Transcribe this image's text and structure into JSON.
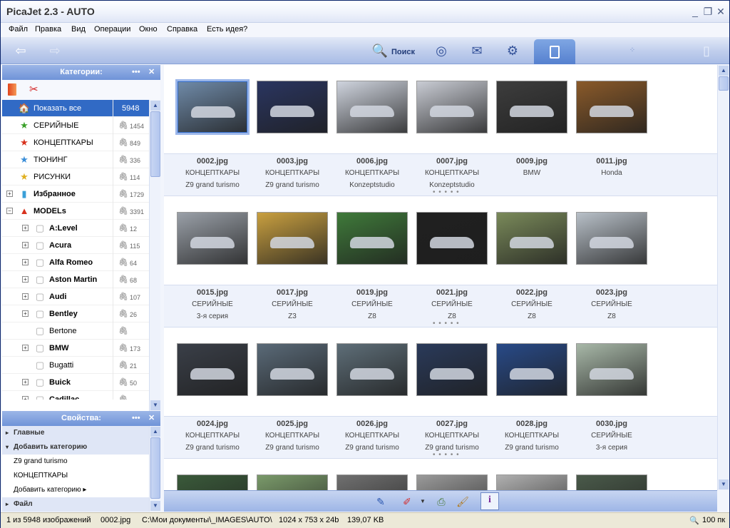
{
  "window": {
    "title": "PicaJet 2.3 - AUTO",
    "minimize": "_",
    "restore": "❐",
    "close": "✕"
  },
  "menu": [
    "Файл",
    "Правка",
    "Вид",
    "Операции",
    "Окно",
    "Справка",
    "Есть идея?"
  ],
  "toolbar": {
    "search_label": "Поиск",
    "back_icon": "back-arrow",
    "forward_icon": "forward-arrow"
  },
  "categories_panel": {
    "title": "Категории:",
    "dots": "•••",
    "close": "✕"
  },
  "categories": [
    {
      "label": "Показать все",
      "count": "5948",
      "icon": "home",
      "bold": false,
      "selected": true
    },
    {
      "label": "СЕРИЙНЫЕ",
      "count": "1454",
      "icon": "star-green"
    },
    {
      "label": "КОНЦЕПТКАРЫ",
      "count": "849",
      "icon": "star-red"
    },
    {
      "label": "ТЮНИНГ",
      "count": "336",
      "icon": "star-blue"
    },
    {
      "label": "РИСУНКИ",
      "count": "114",
      "icon": "star-yellow"
    },
    {
      "label": "Избранное",
      "count": "1729",
      "icon": "cylinder",
      "bold": true,
      "expand": "+"
    },
    {
      "label": "MODELs",
      "count": "3391",
      "icon": "cone",
      "bold": true,
      "expand": "−"
    },
    {
      "label": "A:Level",
      "count": "12",
      "bold": true,
      "expand": "+",
      "indent": true
    },
    {
      "label": "Acura",
      "count": "115",
      "bold": true,
      "expand": "+",
      "indent": true
    },
    {
      "label": "Alfa Romeo",
      "count": "64",
      "bold": true,
      "expand": "+",
      "indent": true
    },
    {
      "label": "Aston Martin",
      "count": "68",
      "bold": true,
      "expand": "+",
      "indent": true
    },
    {
      "label": "Audi",
      "count": "107",
      "bold": true,
      "expand": "+",
      "indent": true
    },
    {
      "label": "Bentley",
      "count": "26",
      "bold": true,
      "expand": "+",
      "indent": true
    },
    {
      "label": "Bertone",
      "count": "",
      "bold": false,
      "indent": true
    },
    {
      "label": "BMW",
      "count": "173",
      "bold": true,
      "expand": "+",
      "indent": true
    },
    {
      "label": "Bugatti",
      "count": "21",
      "bold": false,
      "indent": true
    },
    {
      "label": "Buick",
      "count": "50",
      "bold": true,
      "expand": "+",
      "indent": true
    },
    {
      "label": "Cadillac",
      "count": "",
      "bold": true,
      "expand": "+",
      "indent": true
    }
  ],
  "properties_panel": {
    "title": "Свойства:",
    "dots": "•••",
    "close": "✕"
  },
  "properties": [
    {
      "type": "h",
      "label": "Главные",
      "tri": "▸"
    },
    {
      "type": "h",
      "label": "Добавить категорию",
      "tri": "▾"
    },
    {
      "type": "i",
      "label": "Z9 grand turismo"
    },
    {
      "type": "i",
      "label": "КОНЦЕПТКАРЫ"
    },
    {
      "type": "i",
      "label": "Добавить категорию ▸"
    },
    {
      "type": "h",
      "label": "Файл",
      "tri": "▸"
    }
  ],
  "thumbnails": [
    [
      {
        "file": "0002.jpg",
        "cat": "КОНЦЕПТКАРЫ",
        "note": "Z9 grand turismo",
        "color": "#6f8aa8",
        "selected": true
      },
      {
        "file": "0003.jpg",
        "cat": "КОНЦЕПТКАРЫ",
        "note": "Z9 grand turismo",
        "color": "#2a3560"
      },
      {
        "file": "0006.jpg",
        "cat": "КОНЦЕПТКАРЫ",
        "note": "Konzeptstudio",
        "color": "#cfd4de"
      },
      {
        "file": "0007.jpg",
        "cat": "КОНЦЕПТКАРЫ",
        "note": "Konzeptstudio",
        "color": "#c9ccd4"
      },
      {
        "file": "0009.jpg",
        "cat": "BMW",
        "note": "",
        "color": "#3d3d3d"
      },
      {
        "file": "0011.jpg",
        "cat": "Honda",
        "note": "",
        "color": "#8a5a2a"
      }
    ],
    [
      {
        "file": "0015.jpg",
        "cat": "СЕРИЙНЫЕ",
        "note": "3-я серия",
        "color": "#9aa0a8"
      },
      {
        "file": "0017.jpg",
        "cat": "СЕРИЙНЫЕ",
        "note": "Z3",
        "color": "#c9a040"
      },
      {
        "file": "0019.jpg",
        "cat": "СЕРИЙНЫЕ",
        "note": "Z8",
        "color": "#3f7a3a"
      },
      {
        "file": "0021.jpg",
        "cat": "СЕРИЙНЫЕ",
        "note": "Z8",
        "color": "#202020"
      },
      {
        "file": "0022.jpg",
        "cat": "СЕРИЙНЫЕ",
        "note": "Z8",
        "color": "#7a8a5a"
      },
      {
        "file": "0023.jpg",
        "cat": "СЕРИЙНЫЕ",
        "note": "Z8",
        "color": "#b8c0c8"
      }
    ],
    [
      {
        "file": "0024.jpg",
        "cat": "КОНЦЕПТКАРЫ",
        "note": "Z9 grand turismo",
        "color": "#3a3f48"
      },
      {
        "file": "0025.jpg",
        "cat": "КОНЦЕПТКАРЫ",
        "note": "Z9 grand turismo",
        "color": "#5a6a78"
      },
      {
        "file": "0026.jpg",
        "cat": "КОНЦЕПТКАРЫ",
        "note": "Z9 grand turismo",
        "color": "#5e6e78"
      },
      {
        "file": "0027.jpg",
        "cat": "КОНЦЕПТКАРЫ",
        "note": "Z9 grand turismo",
        "color": "#2a3a5a"
      },
      {
        "file": "0028.jpg",
        "cat": "КОНЦЕПТКАРЫ",
        "note": "Z9 grand turismo",
        "color": "#284a88"
      },
      {
        "file": "0030.jpg",
        "cat": "СЕРИЙНЫЕ",
        "note": "3-я серия",
        "color": "#a8b8a8"
      }
    ],
    [
      {
        "file": "",
        "cat": "",
        "note": "",
        "color": "#3a5a3a"
      },
      {
        "file": "",
        "cat": "",
        "note": "",
        "color": "#7a9a6a"
      },
      {
        "file": "",
        "cat": "",
        "note": "",
        "color": "#707070"
      },
      {
        "file": "",
        "cat": "",
        "note": "",
        "color": "#9a9a9a"
      },
      {
        "file": "",
        "cat": "",
        "note": "",
        "color": "#b0b0b0"
      },
      {
        "file": "",
        "cat": "",
        "note": "",
        "color": "#4a5a4a"
      }
    ]
  ],
  "more_dots": "• • • • •",
  "status": {
    "count": "1 из 5948 изображений",
    "file": "0002.jpg",
    "path": "C:\\Мои документы\\_IMAGES\\AUTO\\",
    "dims": "1024 x 753 x 24b",
    "size": "139,07 KB",
    "zoom": "100 пк"
  }
}
